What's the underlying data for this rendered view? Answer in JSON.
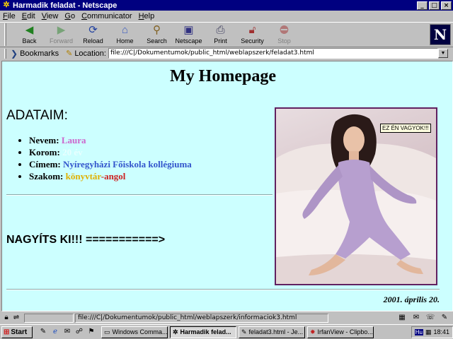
{
  "window": {
    "title": "Harmadik feladat - Netscape",
    "controls": [
      "_",
      "□",
      "×"
    ]
  },
  "menu": [
    {
      "key": "F",
      "rest": "ile"
    },
    {
      "key": "E",
      "rest": "dit"
    },
    {
      "key": "V",
      "rest": "iew"
    },
    {
      "key": "G",
      "rest": "o"
    },
    {
      "key": "C",
      "rest": "ommunicator"
    },
    {
      "key": "H",
      "rest": "elp"
    }
  ],
  "toolbar": {
    "back": "Back",
    "forward": "Forward",
    "reload": "Reload",
    "home": "Home",
    "search": "Search",
    "netscape": "Netscape",
    "print": "Print",
    "security": "Security",
    "stop": "Stop",
    "logo": "N"
  },
  "location": {
    "bookmarks": "Bookmarks",
    "label": "Location:",
    "url": "file:///C|/Dokumentumok/public_html/weblapszerk/feladat3.html"
  },
  "page": {
    "title": "My Homepage",
    "heading": "ADATAIM:",
    "items": {
      "name_label": "Nevem:",
      "name_value": "Laura",
      "age_label": "Korom:",
      "age_value": "20 év",
      "address_label": "Címem:",
      "address_value": "Nyíregyházi Főiskola kollégiuma",
      "major_label": "Szakom:",
      "major_value_1": "könyvtár",
      "major_sep": "-",
      "major_value_2": "angol"
    },
    "zoom_text": "NAGYÍTS KI!!! ===========>",
    "tooltip": "EZ ÉN VAGYOK!!!",
    "date": "2001. április 20."
  },
  "status": {
    "text": "file:///C|/Dokumentumok/public_html/weblapszerk/informaciok3.html"
  },
  "taskbar": {
    "start": "Start",
    "tasks": [
      "Windows Comma...",
      "Harmadik felad...",
      "feladat3.html - Je...",
      "IrfanView - Clipbo..."
    ],
    "lang": "Hu",
    "clock": "18:41"
  }
}
